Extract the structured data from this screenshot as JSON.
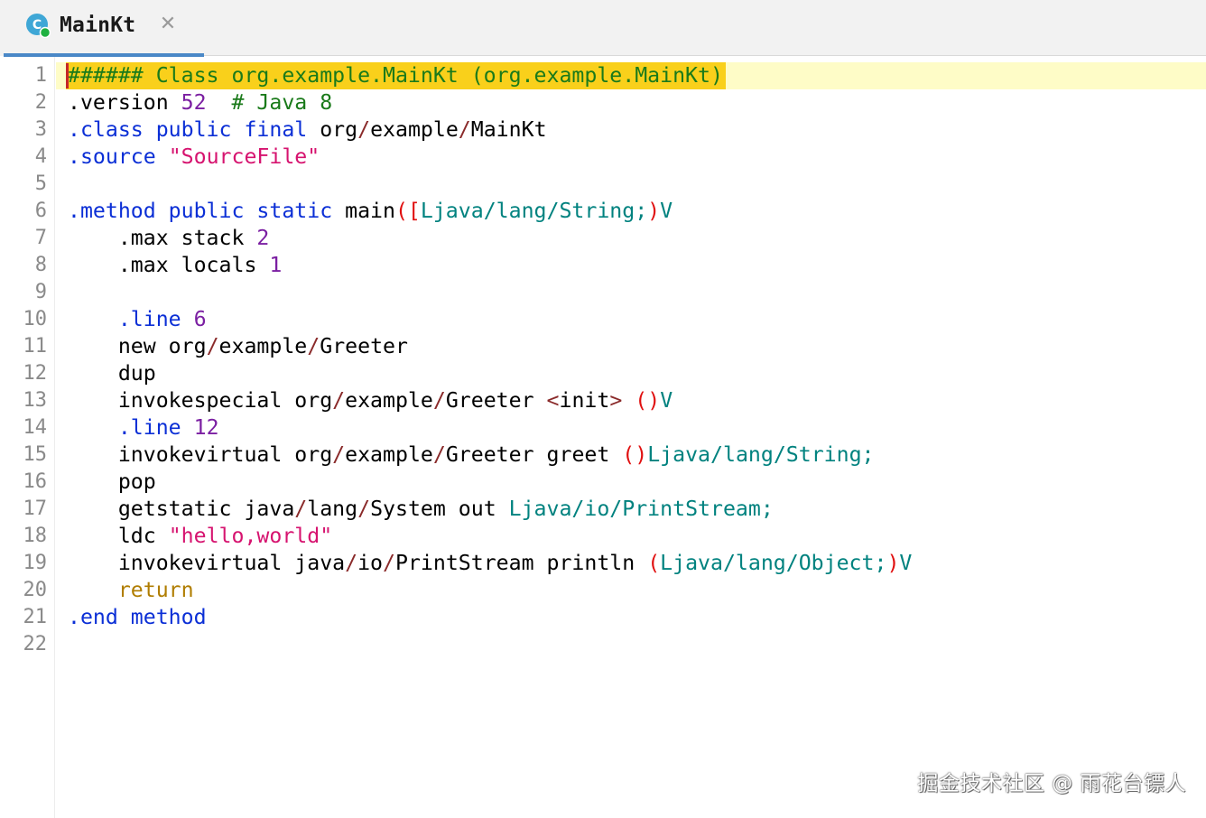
{
  "tab": {
    "title": "MainKt",
    "icon": "kotlin-class-icon",
    "close_icon": "close-icon"
  },
  "editor": {
    "line_numbers": [
      "1",
      "2",
      "3",
      "4",
      "5",
      "6",
      "7",
      "8",
      "9",
      "10",
      "11",
      "12",
      "13",
      "14",
      "15",
      "16",
      "17",
      "18",
      "19",
      "20",
      "21",
      "22"
    ],
    "lines": [
      [
        {
          "t": "###### Class org.example.MainKt (org.example.MainKt)",
          "c": "c-cmt"
        }
      ],
      [
        {
          "t": ".version ",
          "c": "c-txt"
        },
        {
          "t": "52",
          "c": "c-num"
        },
        {
          "t": "  # Java 8",
          "c": "c-cmt"
        }
      ],
      [
        {
          "t": ".class public final ",
          "c": "c-dir"
        },
        {
          "t": "org",
          "c": "c-txt"
        },
        {
          "t": "/",
          "c": "c-sl"
        },
        {
          "t": "example",
          "c": "c-txt"
        },
        {
          "t": "/",
          "c": "c-sl"
        },
        {
          "t": "MainKt",
          "c": "c-txt"
        }
      ],
      [
        {
          "t": ".source ",
          "c": "c-dir"
        },
        {
          "t": "\"SourceFile\"",
          "c": "c-str"
        }
      ],
      [],
      [
        {
          "t": ".method public static ",
          "c": "c-dir"
        },
        {
          "t": "main",
          "c": "c-txt"
        },
        {
          "t": "([",
          "c": "c-par"
        },
        {
          "t": "Ljava/lang/String;",
          "c": "c-typ"
        },
        {
          "t": ")",
          "c": "c-par"
        },
        {
          "t": "V",
          "c": "c-typ"
        }
      ],
      [
        {
          "t": "    .max stack ",
          "c": "c-txt"
        },
        {
          "t": "2",
          "c": "c-num"
        }
      ],
      [
        {
          "t": "    .max locals ",
          "c": "c-txt"
        },
        {
          "t": "1",
          "c": "c-num"
        }
      ],
      [],
      [
        {
          "t": "    ",
          "c": "c-txt"
        },
        {
          "t": ".line ",
          "c": "c-dir"
        },
        {
          "t": "6",
          "c": "c-num"
        }
      ],
      [
        {
          "t": "    new org",
          "c": "c-txt"
        },
        {
          "t": "/",
          "c": "c-sl"
        },
        {
          "t": "example",
          "c": "c-txt"
        },
        {
          "t": "/",
          "c": "c-sl"
        },
        {
          "t": "Greeter",
          "c": "c-txt"
        }
      ],
      [
        {
          "t": "    dup",
          "c": "c-txt"
        }
      ],
      [
        {
          "t": "    invokespecial org",
          "c": "c-txt"
        },
        {
          "t": "/",
          "c": "c-sl"
        },
        {
          "t": "example",
          "c": "c-txt"
        },
        {
          "t": "/",
          "c": "c-sl"
        },
        {
          "t": "Greeter ",
          "c": "c-txt"
        },
        {
          "t": "<",
          "c": "c-sl"
        },
        {
          "t": "init",
          "c": "c-txt"
        },
        {
          "t": ">",
          "c": "c-sl"
        },
        {
          "t": " ",
          "c": "c-txt"
        },
        {
          "t": "()",
          "c": "c-par"
        },
        {
          "t": "V",
          "c": "c-typ"
        }
      ],
      [
        {
          "t": "    ",
          "c": "c-txt"
        },
        {
          "t": ".line ",
          "c": "c-dir"
        },
        {
          "t": "12",
          "c": "c-num"
        }
      ],
      [
        {
          "t": "    invokevirtual org",
          "c": "c-txt"
        },
        {
          "t": "/",
          "c": "c-sl"
        },
        {
          "t": "example",
          "c": "c-txt"
        },
        {
          "t": "/",
          "c": "c-sl"
        },
        {
          "t": "Greeter greet ",
          "c": "c-txt"
        },
        {
          "t": "()",
          "c": "c-par"
        },
        {
          "t": "Ljava/lang/String;",
          "c": "c-typ"
        }
      ],
      [
        {
          "t": "    pop",
          "c": "c-txt"
        }
      ],
      [
        {
          "t": "    getstatic java",
          "c": "c-txt"
        },
        {
          "t": "/",
          "c": "c-sl"
        },
        {
          "t": "lang",
          "c": "c-txt"
        },
        {
          "t": "/",
          "c": "c-sl"
        },
        {
          "t": "System out ",
          "c": "c-txt"
        },
        {
          "t": "Ljava/io/PrintStream;",
          "c": "c-typ"
        }
      ],
      [
        {
          "t": "    ldc ",
          "c": "c-txt"
        },
        {
          "t": "\"hello,world\"",
          "c": "c-str"
        }
      ],
      [
        {
          "t": "    invokevirtual java",
          "c": "c-txt"
        },
        {
          "t": "/",
          "c": "c-sl"
        },
        {
          "t": "io",
          "c": "c-txt"
        },
        {
          "t": "/",
          "c": "c-sl"
        },
        {
          "t": "PrintStream println ",
          "c": "c-txt"
        },
        {
          "t": "(",
          "c": "c-par"
        },
        {
          "t": "Ljava/lang/Object;",
          "c": "c-typ"
        },
        {
          "t": ")",
          "c": "c-par"
        },
        {
          "t": "V",
          "c": "c-typ"
        }
      ],
      [
        {
          "t": "    ",
          "c": "c-txt"
        },
        {
          "t": "return",
          "c": "c-ret"
        }
      ],
      [
        {
          "t": ".end method",
          "c": "c-dir"
        }
      ],
      []
    ]
  },
  "colors": {
    "highlight_row": "#fefcc7",
    "highlight_selection": "#f9d01b",
    "tab_underline": "#4a88c7",
    "caret": "#c62828"
  },
  "watermark": "掘金技术社区 @ 雨花台镖人"
}
